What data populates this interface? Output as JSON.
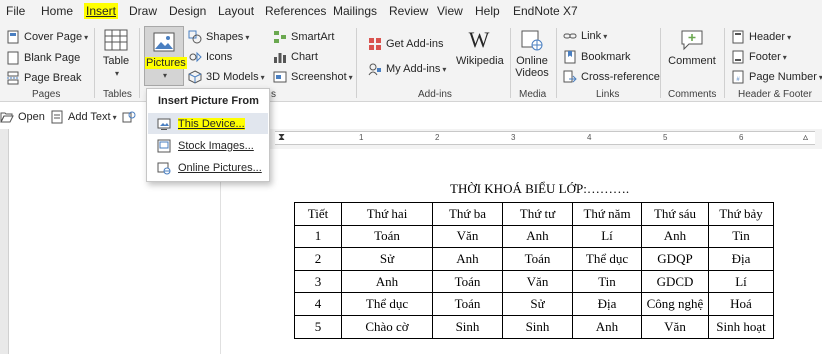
{
  "menu": {
    "tabs": [
      {
        "label": "File"
      },
      {
        "label": "Home"
      },
      {
        "label": "Insert"
      },
      {
        "label": "Draw"
      },
      {
        "label": "Design"
      },
      {
        "label": "Layout"
      },
      {
        "label": "References"
      },
      {
        "label": "Mailings"
      },
      {
        "label": "Review"
      },
      {
        "label": "View"
      },
      {
        "label": "Help"
      },
      {
        "label": "EndNote X7"
      }
    ],
    "active_tab": "Insert"
  },
  "ribbon": {
    "pages": {
      "label": "Pages",
      "cover_page": "Cover Page",
      "blank_page": "Blank Page",
      "page_break": "Page Break"
    },
    "tables": {
      "label": "Tables",
      "table": "Table"
    },
    "illustrations": {
      "pictures": "Pictures",
      "shapes": "Shapes",
      "icons": "Icons",
      "models3d": "3D Models",
      "smartart": "SmartArt",
      "chart": "Chart",
      "screenshot": "Screenshot",
      "group_label_tail": "s"
    },
    "addins": {
      "label": "Add-ins",
      "get_addins": "Get Add-ins",
      "my_addins": "My Add-ins",
      "wikipedia": "Wikipedia"
    },
    "media": {
      "label": "Media",
      "online_videos_line1": "Online",
      "online_videos_line2": "Videos"
    },
    "links": {
      "label": "Links",
      "link": "Link",
      "bookmark": "Bookmark",
      "cross_reference": "Cross-reference"
    },
    "comments": {
      "label": "Comments",
      "comment": "Comment"
    },
    "header_footer": {
      "label": "Header & Footer",
      "header": "Header",
      "footer": "Footer",
      "page_number": "Page Number"
    }
  },
  "quick_toolbar": {
    "open": "Open",
    "add_text": "Add Text"
  },
  "ruler": {
    "numbers": [
      "1",
      "2",
      "3",
      "4",
      "5",
      "6"
    ]
  },
  "dropdown": {
    "title": "Insert Picture From",
    "items": [
      {
        "label": "This Device..."
      },
      {
        "label": "Stock Images..."
      },
      {
        "label": "Online Pictures..."
      }
    ]
  },
  "document": {
    "title": "THỜI KHOÁ BIỂU LỚP:……….",
    "table": {
      "header": [
        "Tiết",
        "Thứ hai",
        "Thứ ba",
        "Thứ tư",
        "Thứ năm",
        "Thứ sáu",
        "Thứ bảy"
      ],
      "rows": [
        [
          "1",
          "Toán",
          "Văn",
          "Anh",
          "Lí",
          "Anh",
          "Tin"
        ],
        [
          "2",
          "Sử",
          "Anh",
          "Toán",
          "Thể dục",
          "GDQP",
          "Địa"
        ],
        [
          "3",
          "Anh",
          "Toán",
          "Văn",
          "Tin",
          "GDCD",
          "Lí"
        ],
        [
          "4",
          "Thể dục",
          "Toán",
          "Sử",
          "Địa",
          "Công nghệ",
          "Hoá"
        ],
        [
          "5",
          "Chào cờ",
          "Sinh",
          "Sinh",
          "Anh",
          "Văn",
          "Sinh hoạt"
        ]
      ]
    }
  },
  "colors": {
    "highlight": "#ffff00",
    "ribbon_bg": "#f3f3f3",
    "hover_bg": "#e1e6ee"
  }
}
